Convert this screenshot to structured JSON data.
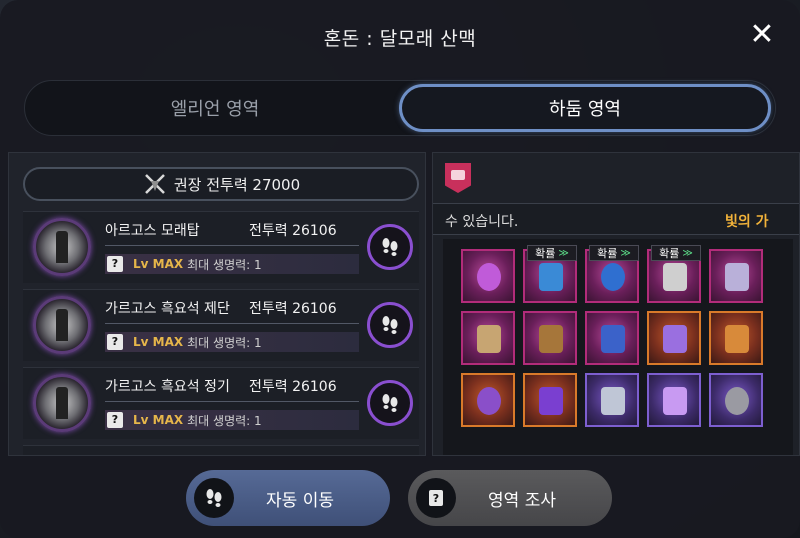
{
  "window": {
    "title": "혼돈 : 달모래 산맥",
    "close_glyph": "✕"
  },
  "tabs": [
    {
      "label": "엘리언 영역",
      "active": false
    },
    {
      "label": "하둠 영역",
      "active": true
    }
  ],
  "left": {
    "header": {
      "label": "권장 전투력 27000"
    },
    "rows": [
      {
        "name": "아르고스 모래탑",
        "power": "전투력 26106",
        "level": "Lv MAX",
        "stat": "최대 생명력: 1"
      },
      {
        "name": "가르고스 흑요석 제단",
        "power": "전투력 26106",
        "level": "Lv MAX",
        "stat": "최대 생명력: 1"
      },
      {
        "name": "가르고스 흑요석 정기",
        "power": "전투력 26106",
        "level": "Lv MAX",
        "stat": "최대 생명력: 1"
      }
    ],
    "q_glyph": "?"
  },
  "right": {
    "desc": "수 있습니다.",
    "desc_gold": "빛의 가",
    "badge_label": "확률",
    "badge_glyph": "≫"
  },
  "buttons": {
    "auto_move": "자동 이동",
    "area_survey": "영역 조사"
  },
  "colors": {
    "accent_blue": "#6e8fc6",
    "purple_ring": "#8a4fd0",
    "gold": "#f2b33a"
  }
}
